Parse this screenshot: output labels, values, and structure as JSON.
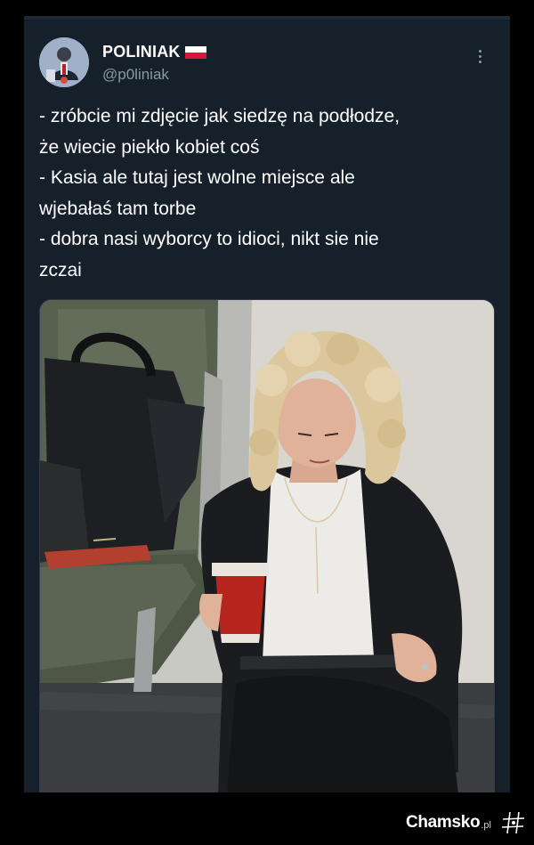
{
  "tweet": {
    "display_name": "POLINIAK",
    "name_flag": "flag-poland-icon",
    "handle": "@p0liniak",
    "lines": [
      "- zróbcie mi zdjęcie jak siedzę na podłodze,",
      "że wiecie piekło kobiet coś",
      "- Kasia ale tutaj jest wolne miejsce ale",
      "wjebałaś tam torbe",
      "- dobra nasi wyborcy to idioci, nikt sie nie",
      "zczai"
    ],
    "more_icon": "more-vertical-icon",
    "media": "photo-woman-sitting-on-train-floor"
  },
  "watermark": {
    "text": "Chamsko",
    "suffix": ".pl",
    "icon": "hash-logo-icon"
  },
  "colors": {
    "page_background": "#000000",
    "card_background": "#15202b",
    "text_primary": "#ffffff",
    "text_secondary": "#8b98a5",
    "flag_white": "#ffffff",
    "flag_red": "#dc143c"
  }
}
